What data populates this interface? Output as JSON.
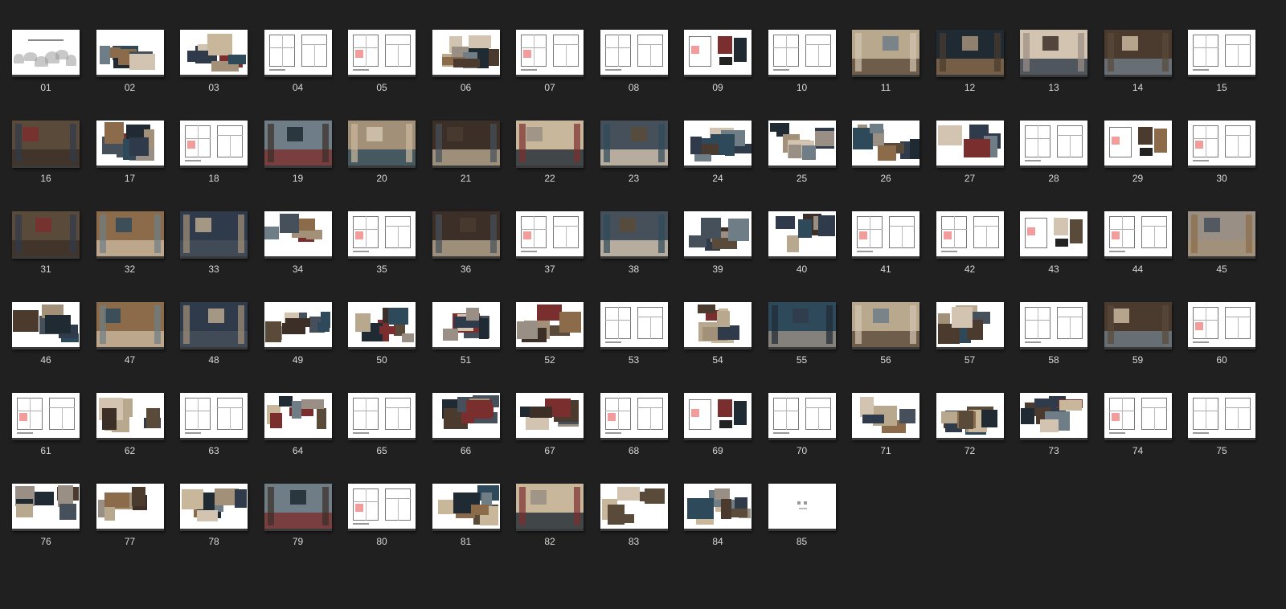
{
  "items": [
    {
      "label": "01",
      "style": "landscape"
    },
    {
      "label": "02",
      "style": "photo-collage"
    },
    {
      "label": "03",
      "style": "photo-collage"
    },
    {
      "label": "04",
      "style": "floorplan"
    },
    {
      "label": "05",
      "style": "floorplan"
    },
    {
      "label": "06",
      "style": "material-board"
    },
    {
      "label": "07",
      "style": "floorplan"
    },
    {
      "label": "08",
      "style": "floorplan"
    },
    {
      "label": "09",
      "style": "floorplan-photo"
    },
    {
      "label": "10",
      "style": "floorplan"
    },
    {
      "label": "11",
      "style": "interior-photo"
    },
    {
      "label": "12",
      "style": "interior-photo"
    },
    {
      "label": "13",
      "style": "interior-photo"
    },
    {
      "label": "14",
      "style": "interior-photo"
    },
    {
      "label": "15",
      "style": "floorplan"
    },
    {
      "label": "16",
      "style": "interior-photo"
    },
    {
      "label": "17",
      "style": "photo-collage"
    },
    {
      "label": "18",
      "style": "floorplan"
    },
    {
      "label": "19",
      "style": "interior-photo"
    },
    {
      "label": "20",
      "style": "interior-photo"
    },
    {
      "label": "21",
      "style": "interior-photo"
    },
    {
      "label": "22",
      "style": "interior-photo"
    },
    {
      "label": "23",
      "style": "interior-photo"
    },
    {
      "label": "24",
      "style": "photo-collage"
    },
    {
      "label": "25",
      "style": "photo-collage"
    },
    {
      "label": "26",
      "style": "photo-collage"
    },
    {
      "label": "27",
      "style": "photo-collage"
    },
    {
      "label": "28",
      "style": "floorplan"
    },
    {
      "label": "29",
      "style": "floorplan-photo"
    },
    {
      "label": "30",
      "style": "floorplan"
    },
    {
      "label": "31",
      "style": "interior-photo"
    },
    {
      "label": "32",
      "style": "interior-photo"
    },
    {
      "label": "33",
      "style": "interior-photo"
    },
    {
      "label": "34",
      "style": "photo-collage"
    },
    {
      "label": "35",
      "style": "floorplan"
    },
    {
      "label": "36",
      "style": "interior-photo"
    },
    {
      "label": "37",
      "style": "floorplan"
    },
    {
      "label": "38",
      "style": "interior-photo"
    },
    {
      "label": "39",
      "style": "photo-collage"
    },
    {
      "label": "40",
      "style": "photo-collage"
    },
    {
      "label": "41",
      "style": "floorplan"
    },
    {
      "label": "42",
      "style": "floorplan"
    },
    {
      "label": "43",
      "style": "floorplan-photo"
    },
    {
      "label": "44",
      "style": "floorplan"
    },
    {
      "label": "45",
      "style": "interior-photo"
    },
    {
      "label": "46",
      "style": "photo-collage"
    },
    {
      "label": "47",
      "style": "interior-photo"
    },
    {
      "label": "48",
      "style": "interior-photo"
    },
    {
      "label": "49",
      "style": "photo-collage"
    },
    {
      "label": "50",
      "style": "photo-collage"
    },
    {
      "label": "51",
      "style": "photo-collage"
    },
    {
      "label": "52",
      "style": "photo-collage"
    },
    {
      "label": "53",
      "style": "floorplan"
    },
    {
      "label": "54",
      "style": "photo-collage"
    },
    {
      "label": "55",
      "style": "interior-photo"
    },
    {
      "label": "56",
      "style": "interior-photo"
    },
    {
      "label": "57",
      "style": "photo-collage"
    },
    {
      "label": "58",
      "style": "floorplan"
    },
    {
      "label": "59",
      "style": "interior-photo"
    },
    {
      "label": "60",
      "style": "floorplan"
    },
    {
      "label": "61",
      "style": "floorplan"
    },
    {
      "label": "62",
      "style": "photo-collage"
    },
    {
      "label": "63",
      "style": "floorplan"
    },
    {
      "label": "64",
      "style": "photo-collage"
    },
    {
      "label": "65",
      "style": "floorplan"
    },
    {
      "label": "66",
      "style": "photo-collage"
    },
    {
      "label": "67",
      "style": "photo-collage"
    },
    {
      "label": "68",
      "style": "floorplan"
    },
    {
      "label": "69",
      "style": "floorplan-photo"
    },
    {
      "label": "70",
      "style": "floorplan"
    },
    {
      "label": "71",
      "style": "photo-collage"
    },
    {
      "label": "72",
      "style": "photo-collage"
    },
    {
      "label": "73",
      "style": "photo-collage"
    },
    {
      "label": "74",
      "style": "floorplan"
    },
    {
      "label": "75",
      "style": "floorplan"
    },
    {
      "label": "76",
      "style": "photo-collage"
    },
    {
      "label": "77",
      "style": "photo-collage"
    },
    {
      "label": "78",
      "style": "photo-collage"
    },
    {
      "label": "79",
      "style": "interior-photo"
    },
    {
      "label": "80",
      "style": "floorplan"
    },
    {
      "label": "81",
      "style": "photo-collage"
    },
    {
      "label": "82",
      "style": "interior-photo"
    },
    {
      "label": "83",
      "style": "photo-collage"
    },
    {
      "label": "84",
      "style": "photo-collage"
    },
    {
      "label": "85",
      "style": "blank"
    }
  ],
  "colors": {
    "background": "#202020",
    "label": "#d8d8d8",
    "thumb_paper": "#ffffff"
  }
}
